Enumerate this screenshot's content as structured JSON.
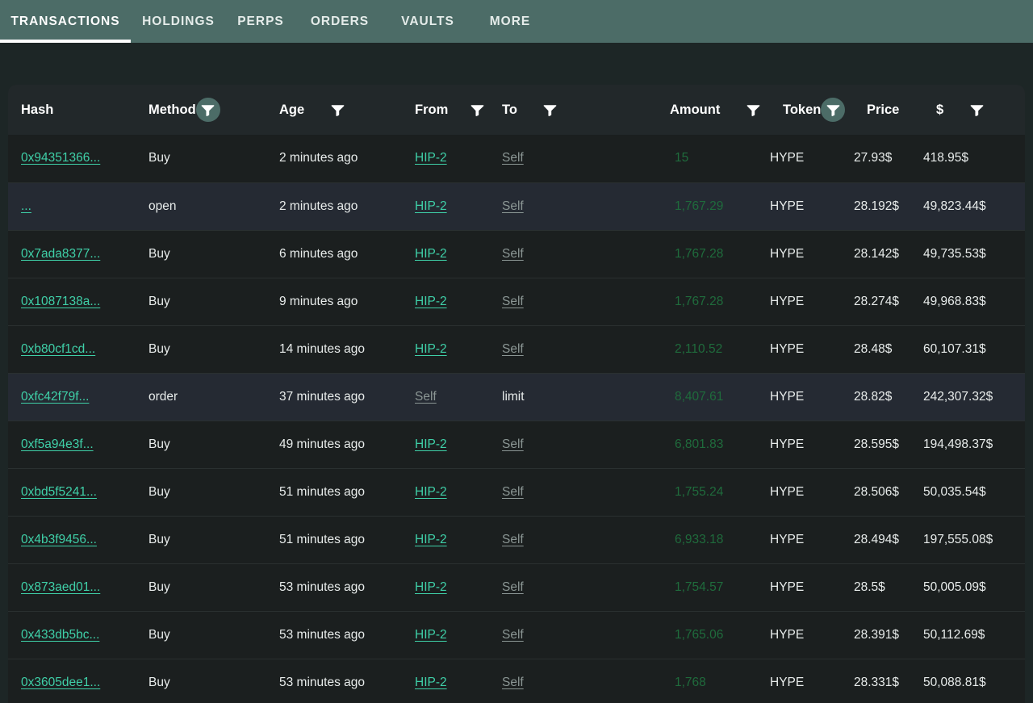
{
  "tabs": [
    {
      "label": "TRANSACTIONS",
      "active": true
    },
    {
      "label": "HOLDINGS",
      "active": false
    },
    {
      "label": "PERPS",
      "active": false
    },
    {
      "label": "ORDERS",
      "active": false
    },
    {
      "label": "VAULTS",
      "active": false
    },
    {
      "label": "MORE",
      "active": false
    }
  ],
  "table": {
    "columns": [
      {
        "key": "hash",
        "label": "Hash",
        "filter": "none"
      },
      {
        "key": "method",
        "label": "Method",
        "filter": "active"
      },
      {
        "key": "age",
        "label": "Age",
        "filter": "inactive"
      },
      {
        "key": "from",
        "label": "From",
        "filter": "inactive"
      },
      {
        "key": "to",
        "label": "To",
        "filter": "inactive"
      },
      {
        "key": "amount",
        "label": "Amount",
        "filter": "inactive"
      },
      {
        "key": "token",
        "label": "Token",
        "filter": "active"
      },
      {
        "key": "price",
        "label": "Price",
        "filter": "none"
      },
      {
        "key": "usd",
        "label": "$",
        "filter": "inactive"
      }
    ],
    "rows": [
      {
        "hash": "0x94351366...",
        "method": "Buy",
        "age": "2 minutes ago",
        "from": "HIP-2",
        "from_style": "link",
        "to": "Self",
        "to_style": "muted-link",
        "amount": "15",
        "token": "HYPE",
        "price": "27.93$",
        "usd": "418.95$",
        "highlight": false
      },
      {
        "hash": "...",
        "method": "open",
        "age": "2 minutes ago",
        "from": "HIP-2",
        "from_style": "link",
        "to": "Self",
        "to_style": "muted-link",
        "amount": "1,767.29",
        "token": "HYPE",
        "price": "28.192$",
        "usd": "49,823.44$",
        "highlight": true
      },
      {
        "hash": "0x7ada8377...",
        "method": "Buy",
        "age": "6 minutes ago",
        "from": "HIP-2",
        "from_style": "link",
        "to": "Self",
        "to_style": "muted-link",
        "amount": "1,767.28",
        "token": "HYPE",
        "price": "28.142$",
        "usd": "49,735.53$",
        "highlight": false
      },
      {
        "hash": "0x1087138a...",
        "method": "Buy",
        "age": "9 minutes ago",
        "from": "HIP-2",
        "from_style": "link",
        "to": "Self",
        "to_style": "muted-link",
        "amount": "1,767.28",
        "token": "HYPE",
        "price": "28.274$",
        "usd": "49,968.83$",
        "highlight": false
      },
      {
        "hash": "0xb80cf1cd...",
        "method": "Buy",
        "age": "14 minutes ago",
        "from": "HIP-2",
        "from_style": "link",
        "to": "Self",
        "to_style": "muted-link",
        "amount": "2,110.52",
        "token": "HYPE",
        "price": "28.48$",
        "usd": "60,107.31$",
        "highlight": false
      },
      {
        "hash": "0xfc42f79f...",
        "method": "order",
        "age": "37 minutes ago",
        "from": "Self",
        "from_style": "muted-link",
        "to": "limit",
        "to_style": "plain",
        "amount": "8,407.61",
        "token": "HYPE",
        "price": "28.82$",
        "usd": "242,307.32$",
        "highlight": true
      },
      {
        "hash": "0xf5a94e3f...",
        "method": "Buy",
        "age": "49 minutes ago",
        "from": "HIP-2",
        "from_style": "link",
        "to": "Self",
        "to_style": "muted-link",
        "amount": "6,801.83",
        "token": "HYPE",
        "price": "28.595$",
        "usd": "194,498.37$",
        "highlight": false
      },
      {
        "hash": "0xbd5f5241...",
        "method": "Buy",
        "age": "51 minutes ago",
        "from": "HIP-2",
        "from_style": "link",
        "to": "Self",
        "to_style": "muted-link",
        "amount": "1,755.24",
        "token": "HYPE",
        "price": "28.506$",
        "usd": "50,035.54$",
        "highlight": false
      },
      {
        "hash": "0x4b3f9456...",
        "method": "Buy",
        "age": "51 minutes ago",
        "from": "HIP-2",
        "from_style": "link",
        "to": "Self",
        "to_style": "muted-link",
        "amount": "6,933.18",
        "token": "HYPE",
        "price": "28.494$",
        "usd": "197,555.08$",
        "highlight": false
      },
      {
        "hash": "0x873aed01...",
        "method": "Buy",
        "age": "53 minutes ago",
        "from": "HIP-2",
        "from_style": "link",
        "to": "Self",
        "to_style": "muted-link",
        "amount": "1,754.57",
        "token": "HYPE",
        "price": "28.5$",
        "usd": "50,005.09$",
        "highlight": false
      },
      {
        "hash": "0x433db5bc...",
        "method": "Buy",
        "age": "53 minutes ago",
        "from": "HIP-2",
        "from_style": "link",
        "to": "Self",
        "to_style": "muted-link",
        "amount": "1,765.06",
        "token": "HYPE",
        "price": "28.391$",
        "usd": "50,112.69$",
        "highlight": false
      },
      {
        "hash": "0x3605dee1...",
        "method": "Buy",
        "age": "53 minutes ago",
        "from": "HIP-2",
        "from_style": "link",
        "to": "Self",
        "to_style": "muted-link",
        "amount": "1,768",
        "token": "HYPE",
        "price": "28.331$",
        "usd": "50,088.81$",
        "highlight": false
      }
    ]
  },
  "colors": {
    "tabbar": "#4c6c67",
    "page_bg": "#1d2626",
    "card_bg": "#1b1f1f",
    "header_bg": "#22282a",
    "row_highlight": "#252a33",
    "link": "#3fd0a8",
    "amount": "#1f6b3c",
    "muted": "#8b9694"
  }
}
